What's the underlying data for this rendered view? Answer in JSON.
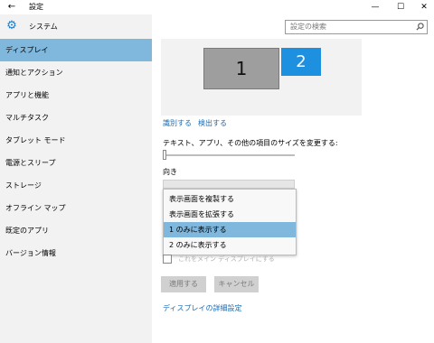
{
  "window": {
    "back_icon": "back-arrow-icon",
    "title": "設定",
    "minimize_glyph": "—",
    "maximize_glyph": "☐",
    "close_glyph": "✕"
  },
  "sidebar": {
    "app_icon": "gear-icon",
    "app_title": "システム",
    "items": [
      {
        "label": "ディスプレイ",
        "active": true
      },
      {
        "label": "通知とアクション",
        "active": false
      },
      {
        "label": "アプリと機能",
        "active": false
      },
      {
        "label": "マルチタスク",
        "active": false
      },
      {
        "label": "タブレット モード",
        "active": false
      },
      {
        "label": "電源とスリープ",
        "active": false
      },
      {
        "label": "ストレージ",
        "active": false
      },
      {
        "label": "オフライン マップ",
        "active": false
      },
      {
        "label": "既定のアプリ",
        "active": false
      },
      {
        "label": "バージョン情報",
        "active": false
      }
    ]
  },
  "search": {
    "placeholder": "設定の検索",
    "icon": "search-icon"
  },
  "display": {
    "monitor_1": "1",
    "monitor_2": "2",
    "identify_link": "識別する",
    "detect_link": "検出する",
    "scale_label": "テキスト、アプリ、その他の項目のサイズを変更する:",
    "scale_level": 0,
    "orientation_label": "向き",
    "multi_display_options": [
      {
        "label": "表示画面を複製する",
        "selected": false
      },
      {
        "label": "表示画面を拡張する",
        "selected": false
      },
      {
        "label": "1 のみに表示する",
        "selected": true
      },
      {
        "label": "2 のみに表示する",
        "selected": false
      }
    ],
    "main_display_checkbox": "これをメイン ディスプレイにする",
    "apply_button": "適用する",
    "cancel_button": "キャンセル",
    "advanced_link": "ディスプレイの詳細設定"
  },
  "colors": {
    "accent": "#1e90e0",
    "selection": "#7fb7dd",
    "link": "#1a6bb5"
  }
}
